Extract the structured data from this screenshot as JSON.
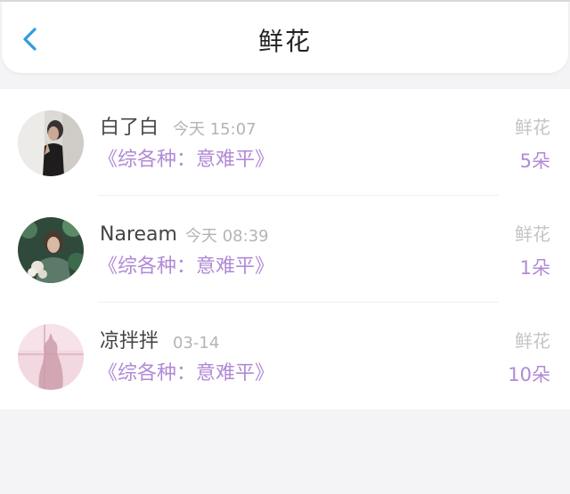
{
  "header": {
    "title": "鲜花",
    "back_icon": "chevron-left-icon",
    "accent": "#2f9be3"
  },
  "colors": {
    "purple": "#b18ad6",
    "gray_text": "#b4b4b8"
  },
  "items": [
    {
      "name": "白了白",
      "time": "今天 15:07",
      "book": "《综各种：意难平》",
      "gift_label": "鲜花",
      "count": "5朵",
      "avatar": "photo of woman in black dress"
    },
    {
      "name": "Naream",
      "time": "今天 08:39",
      "book": "《综各种：意难平》",
      "gift_label": "鲜花",
      "count": "1朵",
      "avatar": "photo of woman with flowers in greenery"
    },
    {
      "name": "凉拌拌",
      "time": "03-14",
      "book": "《综各种：意难平》",
      "gift_label": "鲜花",
      "count": "10朵",
      "avatar": "pink silhouette image"
    }
  ]
}
